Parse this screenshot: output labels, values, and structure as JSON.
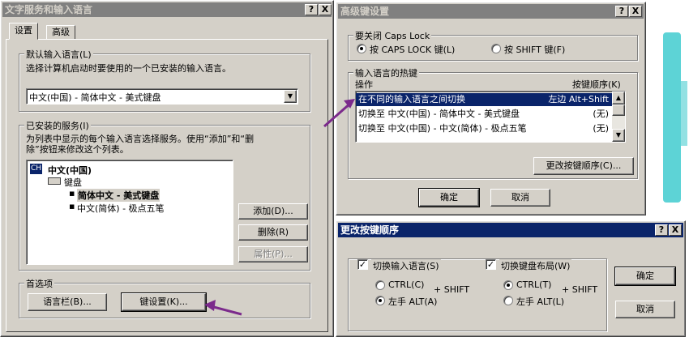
{
  "main": {
    "title": "文字服务和输入语言",
    "tabs": [
      "设置",
      "高级"
    ],
    "default_lang": {
      "title": "默认输入语言(L)",
      "desc": "选择计算机启动时要使用的一个已安装的输入语言。",
      "selected": "中文(中国) - 简体中文 - 美式键盘"
    },
    "services": {
      "title": "已安装的服务(I)",
      "desc1": "为列表中显示的每个输入语言选择服务。使用“添加”和“删",
      "desc2": "除”按钮来修改这个列表。",
      "lang_badge": "CH",
      "lang": "中文(中国)",
      "keyboard": "键盘",
      "items": [
        "简体中文 - 美式键盘",
        "中文(简体) - 极点五笔"
      ]
    },
    "buttons": {
      "add": "添加(D)...",
      "remove": "删除(R)",
      "props": "属性(P)..."
    },
    "prefs": {
      "title": "首选项",
      "langbar": "语言栏(B)...",
      "keysettings": "键设置(K)..."
    }
  },
  "adv": {
    "title": "高级键设置",
    "caps": {
      "title": "要关闭 Caps Lock",
      "opt1": "按 CAPS LOCK 键(L)",
      "opt2": "按 SHIFT 键(F)"
    },
    "hotkeys": {
      "title": "输入语言的热键",
      "col_action": "操作",
      "col_key": "按键顺序(K)",
      "rows": [
        {
          "action": "在不同的输入语言之间切换",
          "key": "左边 Alt+Shift"
        },
        {
          "action": "切换至 中文(中国) - 简体中文 - 美式键盘",
          "key": "(无)"
        },
        {
          "action": "切换至 中文(中国) - 中文(简体) - 极点五笔",
          "key": "(无)"
        }
      ],
      "change_button": "更改按键顺序(C)..."
    },
    "ok": "确定",
    "cancel": "取消"
  },
  "change": {
    "title": "更改按键顺序",
    "switch_lang": "切换输入语言(S)",
    "switch_layout": "切换键盘布局(W)",
    "ctrl_c": "CTRL(C)",
    "alt_a": "左手 ALT(A)",
    "ctrl_t": "CTRL(T)",
    "alt_l": "左手 ALT(L)",
    "plus_shift": "+ SHIFT",
    "ok": "确定",
    "cancel": "取消"
  },
  "titlebar_buttons": {
    "help": "?",
    "close": "X"
  },
  "colors": {
    "arrow": "#7b2a8c",
    "selection": "#0a246a",
    "smudge": "#27c4c8"
  }
}
